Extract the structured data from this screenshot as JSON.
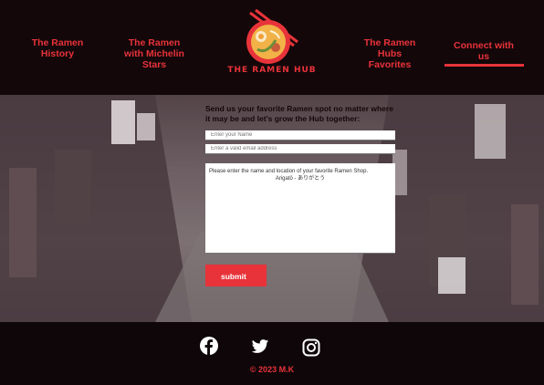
{
  "nav": {
    "history": "The Ramen History",
    "michelin": "The Ramen with Michelin Stars",
    "favorites": "The Ramen Hubs Favorites",
    "connect": "Connect with us"
  },
  "logo": {
    "text": "THE RAMEN HUB",
    "icon": "ramen-bowl-icon"
  },
  "form": {
    "title": "Send us your favorite Ramen spot no matter where it may be and let's grow the Hub together:",
    "name_placeholder": "Enter your Name",
    "email_placeholder": "Enter a valid email address",
    "message_line1": "Please enter the name and location of your favorite Ramen Shop.",
    "message_line2": "Arigatō - ありがとう",
    "submit_label": "submit"
  },
  "footer": {
    "facebook_icon": "facebook-icon",
    "twitter_icon": "twitter-icon",
    "instagram_icon": "instagram-icon",
    "copyright": "© 2023 M.K"
  },
  "colors": {
    "accent": "#e8333a",
    "header_bg": "#140709",
    "footer_bg": "#0e0608"
  }
}
